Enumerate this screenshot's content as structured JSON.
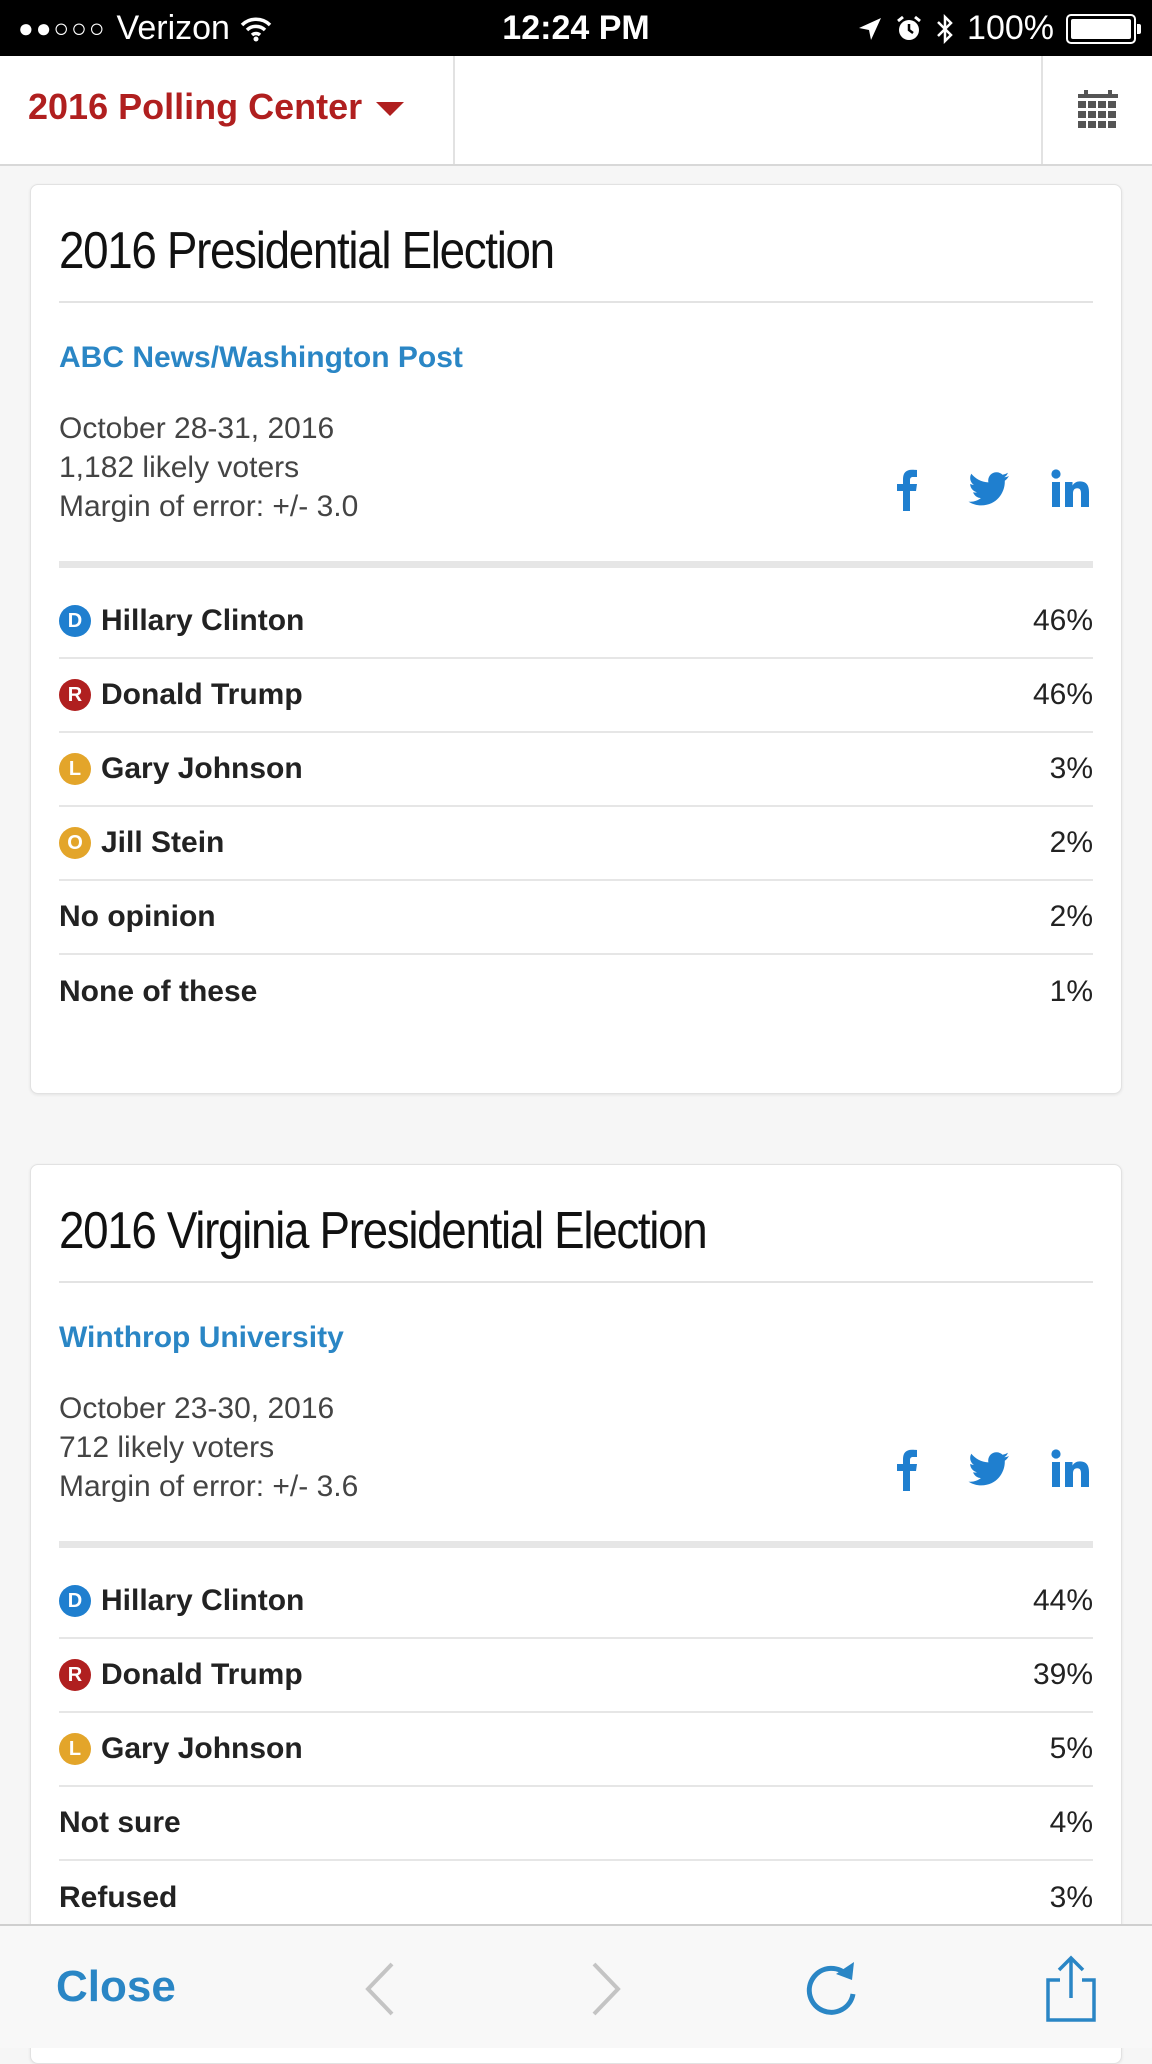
{
  "status_bar": {
    "signal": "●●○○○",
    "carrier": "Verizon",
    "time": "12:24 PM",
    "battery": "100%",
    "battery_level": 1.0
  },
  "header": {
    "title": "2016 Polling Center"
  },
  "polls": [
    {
      "title": "2016 Presidential Election",
      "pollster": "ABC News/Washington Post",
      "dates": "October 28-31, 2016",
      "sample": "1,182 likely voters",
      "margin": "Margin of error: +/- 3.0",
      "results": [
        {
          "party": "D",
          "name": "Hillary Clinton",
          "pct": "46%"
        },
        {
          "party": "R",
          "name": "Donald Trump",
          "pct": "46%"
        },
        {
          "party": "L",
          "name": "Gary Johnson",
          "pct": "3%"
        },
        {
          "party": "O",
          "name": "Jill Stein",
          "pct": "2%"
        },
        {
          "party": "",
          "name": "No opinion",
          "pct": "2%"
        },
        {
          "party": "",
          "name": "None of these",
          "pct": "1%"
        }
      ]
    },
    {
      "title": "2016 Virginia Presidential Election",
      "pollster": "Winthrop University",
      "dates": "October 23-30, 2016",
      "sample": "712 likely voters",
      "margin": "Margin of error: +/- 3.6",
      "results": [
        {
          "party": "D",
          "name": "Hillary Clinton",
          "pct": "44%"
        },
        {
          "party": "R",
          "name": "Donald Trump",
          "pct": "39%"
        },
        {
          "party": "L",
          "name": "Gary Johnson",
          "pct": "5%"
        },
        {
          "party": "",
          "name": "Not sure",
          "pct": "4%"
        },
        {
          "party": "",
          "name": "Refused",
          "pct": "3%"
        }
      ]
    }
  ],
  "party_colors": {
    "D": "#1f7fcf",
    "R": "#b01f1f",
    "L": "#e3a52a",
    "O": "#e3a52a"
  },
  "icons": {
    "share": [
      "facebook-icon",
      "twitter-icon",
      "linkedin-icon"
    ],
    "toolbar": [
      "back-arrow-icon",
      "forward-arrow-icon",
      "reload-icon",
      "share-icon"
    ]
  },
  "toolbar": {
    "close_label": "Close"
  },
  "colors": {
    "accent": "#b01f1f",
    "link": "#2a86c5"
  }
}
